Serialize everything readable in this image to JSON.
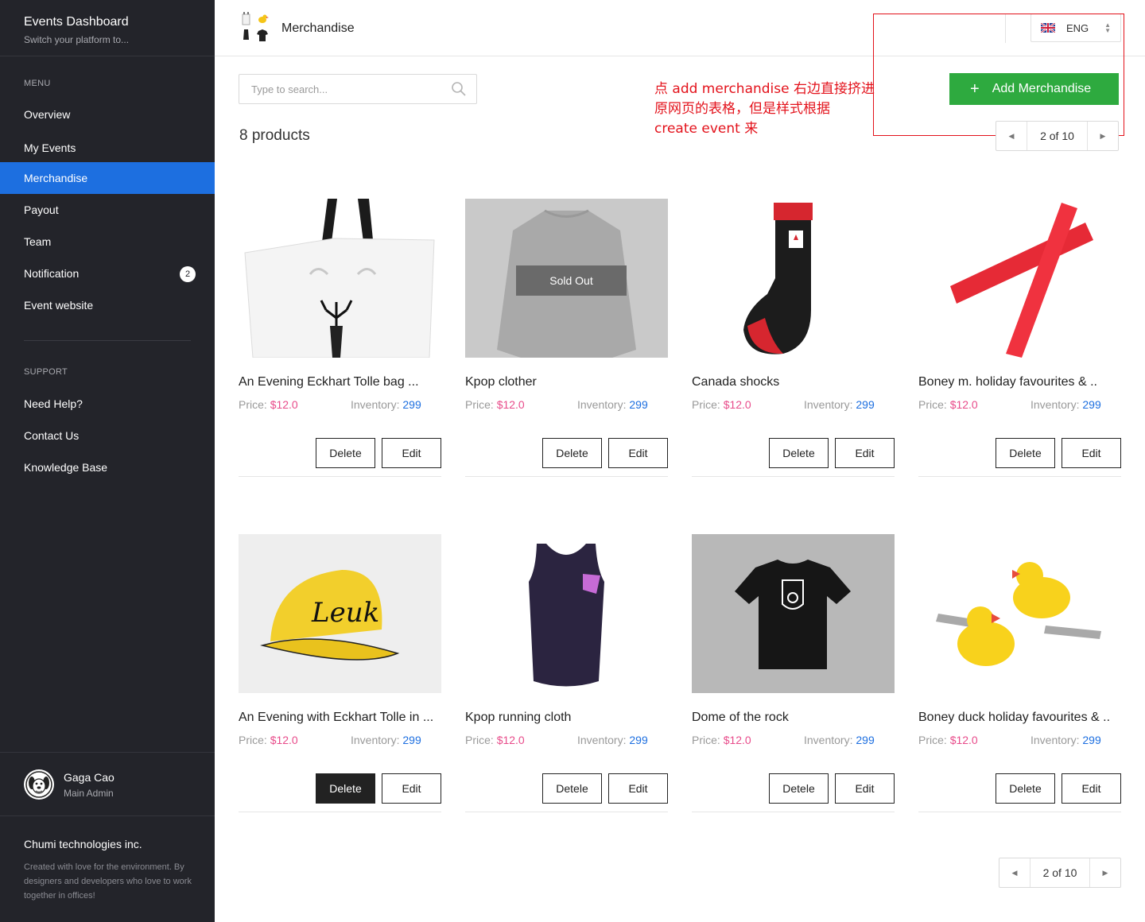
{
  "sidebar": {
    "title": "Events Dashboard",
    "subtitle": "Switch your platform to...",
    "menu_label": "MENU",
    "menu": [
      {
        "label": "Overview"
      },
      {
        "label": "My Events"
      },
      {
        "label": "Merchandise",
        "active": true
      },
      {
        "label": "Payout"
      },
      {
        "label": "Team"
      },
      {
        "label": "Notification",
        "badge": "2"
      },
      {
        "label": "Event website"
      }
    ],
    "support_label": "SUPPORT",
    "support": [
      {
        "label": "Need Help?"
      },
      {
        "label": "Contact Us"
      },
      {
        "label": "Knowledge Base"
      }
    ],
    "user": {
      "name": "Gaga Cao",
      "role": "Main Admin"
    },
    "company": "Chumi technologies inc.",
    "copy": "Created with love for the environment. By designers and developers who love to work together in offices!"
  },
  "header": {
    "title": "Merchandise",
    "language": "ENG"
  },
  "search": {
    "placeholder": "Type to search..."
  },
  "products_count": "8 products",
  "annotation": "点 add merchandise 右边直接挤进\n原网页的表格，但是样式根据\ncreate event 来",
  "add_button": "Add Merchandise",
  "pagination": {
    "top": "2 of 10",
    "bottom": "2 of 10"
  },
  "labels": {
    "price": "Price:",
    "inventory": "Inventory:"
  },
  "sold_out": "Sold Out",
  "products": [
    {
      "name": "An Evening Eckhart Tolle bag ...",
      "price": "$12.0",
      "inventory": "299",
      "delete": "Delete",
      "edit": "Edit"
    },
    {
      "name": "Kpop clother",
      "price": "$12.0",
      "inventory": "299",
      "delete": "Delete",
      "edit": "Edit"
    },
    {
      "name": "Canada shocks",
      "price": "$12.0",
      "inventory": "299",
      "delete": "Delete",
      "edit": "Edit"
    },
    {
      "name": "Boney m. holiday favourites & ..",
      "price": "$12.0",
      "inventory": "299",
      "delete": "Delete",
      "edit": "Edit"
    },
    {
      "name": "An Evening with Eckhart Tolle in ...",
      "price": "$12.0",
      "inventory": "299",
      "delete": "Delete",
      "edit": "Edit"
    },
    {
      "name": "Kpop running  cloth",
      "price": "$12.0",
      "inventory": "299",
      "delete": "Detele",
      "edit": "Edit"
    },
    {
      "name": "Dome of the rock",
      "price": "$12.0",
      "inventory": "299",
      "delete": "Detele",
      "edit": "Edit"
    },
    {
      "name": "Boney duck holiday favourites & ..",
      "price": "$12.0",
      "inventory": "299",
      "delete": "Delete",
      "edit": "Edit"
    }
  ],
  "colors": {
    "sidebar_bg": "#23242a",
    "active_blue": "#1d6fe0",
    "add_green": "#2eaa3f",
    "price_pink": "#e84b8a",
    "annotation_red": "#e3121b"
  },
  "icons": [
    "search-icon",
    "flag-uk-icon",
    "sort-caret-icon",
    "plus-icon",
    "chevron-left-icon",
    "chevron-right-icon"
  ]
}
